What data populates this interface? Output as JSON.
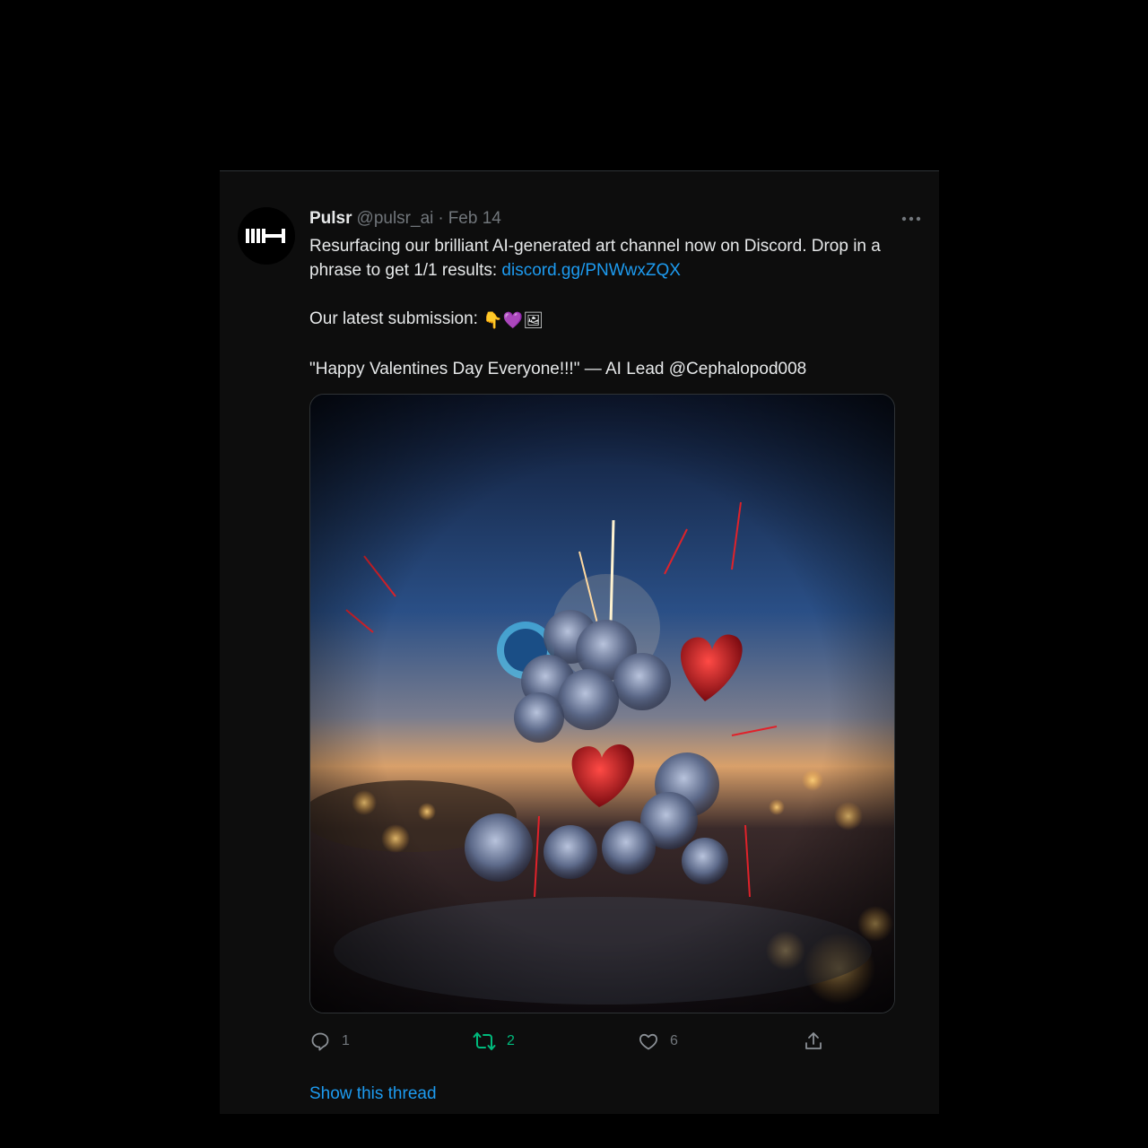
{
  "tweet": {
    "author": {
      "display_name": "Pulsr",
      "handle": "@pulsr_ai",
      "avatar_icon": "pulsr-logo-icon"
    },
    "separator": "·",
    "date": "Feb 14",
    "more_icon": "more-horizontal-icon",
    "text": {
      "line1_prefix": "Resurfacing our brilliant AI-generated art channel now on Discord. Drop in a phrase to get 1/1 results: ",
      "link": "discord.gg/PNWwxZQX",
      "line2_text": "Our latest submission: ",
      "line2_emojis": [
        "👇",
        "💜",
        "🖼"
      ],
      "line3_text": "\"Happy Valentines Day Everyone!!!\" — AI Lead @Cephalopod008"
    },
    "media": {
      "icon": "ai-art-image",
      "colors": {
        "sky_top": "#0f1f3a",
        "sky_mid": "#2a4f86",
        "horizon": "#d9a06a",
        "heart": "#c0141e"
      }
    },
    "actions": {
      "reply": {
        "icon": "reply-icon",
        "count": "1"
      },
      "retweet": {
        "icon": "retweet-icon",
        "count": "2"
      },
      "like": {
        "icon": "heart-icon",
        "count": "6"
      },
      "share": {
        "icon": "share-icon"
      }
    },
    "show_thread": "Show this thread"
  },
  "colors": {
    "background": "#000000",
    "card": "#0d0d0d",
    "text_primary": "#e7e9ea",
    "text_secondary": "#71767b",
    "link": "#1d9bf0",
    "retweet": "#00ba7c"
  }
}
